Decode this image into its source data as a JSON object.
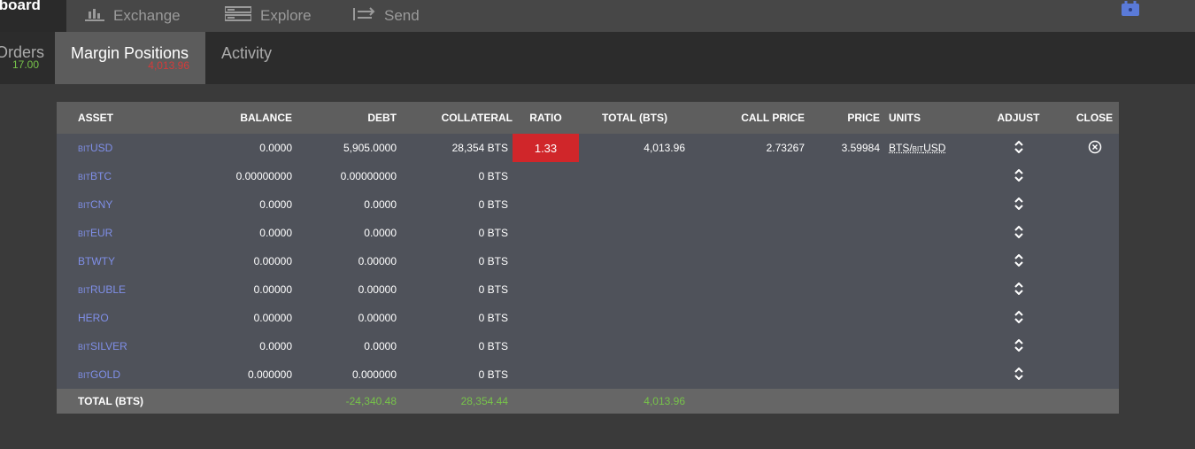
{
  "topnav": {
    "active": "ıboard",
    "items": [
      {
        "label": "Exchange",
        "icon": "chart-icon"
      },
      {
        "label": "Explore",
        "icon": "server-icon"
      },
      {
        "label": "Send",
        "icon": "transfer-icon"
      }
    ],
    "lock_icon": "lock-icon"
  },
  "subtabs": {
    "orders": {
      "label": "Orders",
      "count": "17.00"
    },
    "margin": {
      "label": "Margin Positions",
      "count": "4,013.96"
    },
    "activity": {
      "label": "Activity"
    }
  },
  "table": {
    "headers": {
      "asset": "ASSET",
      "balance": "BALANCE",
      "debt": "DEBT",
      "collateral": "COLLATERAL",
      "ratio": "RATIO",
      "total": "TOTAL (BTS)",
      "call_price": "CALL PRICE",
      "price": "PRICE",
      "units": "UNITS",
      "adjust": "ADJUST",
      "close": "CLOSE"
    },
    "rows": [
      {
        "prefix": "BIT",
        "asset": "USD",
        "balance": "0.0000",
        "debt": "5,905.0000",
        "collateral": "28,354 BTS",
        "ratio": "1.33",
        "total": "4,013.96",
        "call_price": "2.73267",
        "price": "3.59984",
        "units_a": "BTS/",
        "units_prefix": "BIT",
        "units_b": "USD"
      },
      {
        "prefix": "BIT",
        "asset": "BTC",
        "balance": "0.00000000",
        "debt": "0.00000000",
        "collateral": "0 BTS"
      },
      {
        "prefix": "BIT",
        "asset": "CNY",
        "balance": "0.0000",
        "debt": "0.0000",
        "collateral": "0 BTS"
      },
      {
        "prefix": "BIT",
        "asset": "EUR",
        "balance": "0.0000",
        "debt": "0.0000",
        "collateral": "0 BTS"
      },
      {
        "prefix": "",
        "asset": "BTWTY",
        "balance": "0.00000",
        "debt": "0.00000",
        "collateral": "0 BTS"
      },
      {
        "prefix": "BIT",
        "asset": "RUBLE",
        "balance": "0.00000",
        "debt": "0.00000",
        "collateral": "0 BTS"
      },
      {
        "prefix": "",
        "asset": "HERO",
        "balance": "0.00000",
        "debt": "0.00000",
        "collateral": "0 BTS"
      },
      {
        "prefix": "BIT",
        "asset": "SILVER",
        "balance": "0.0000",
        "debt": "0.0000",
        "collateral": "0 BTS"
      },
      {
        "prefix": "BIT",
        "asset": "GOLD",
        "balance": "0.000000",
        "debt": "0.000000",
        "collateral": "0 BTS"
      }
    ],
    "footer": {
      "label": "TOTAL (BTS)",
      "debt": "-24,340.48",
      "collateral": "28,354.44",
      "total": "4,013.96"
    },
    "colors": {
      "ratio_bad": "#d0262a",
      "positive": "#77c34a",
      "asset_link": "#7f8fe8"
    }
  }
}
